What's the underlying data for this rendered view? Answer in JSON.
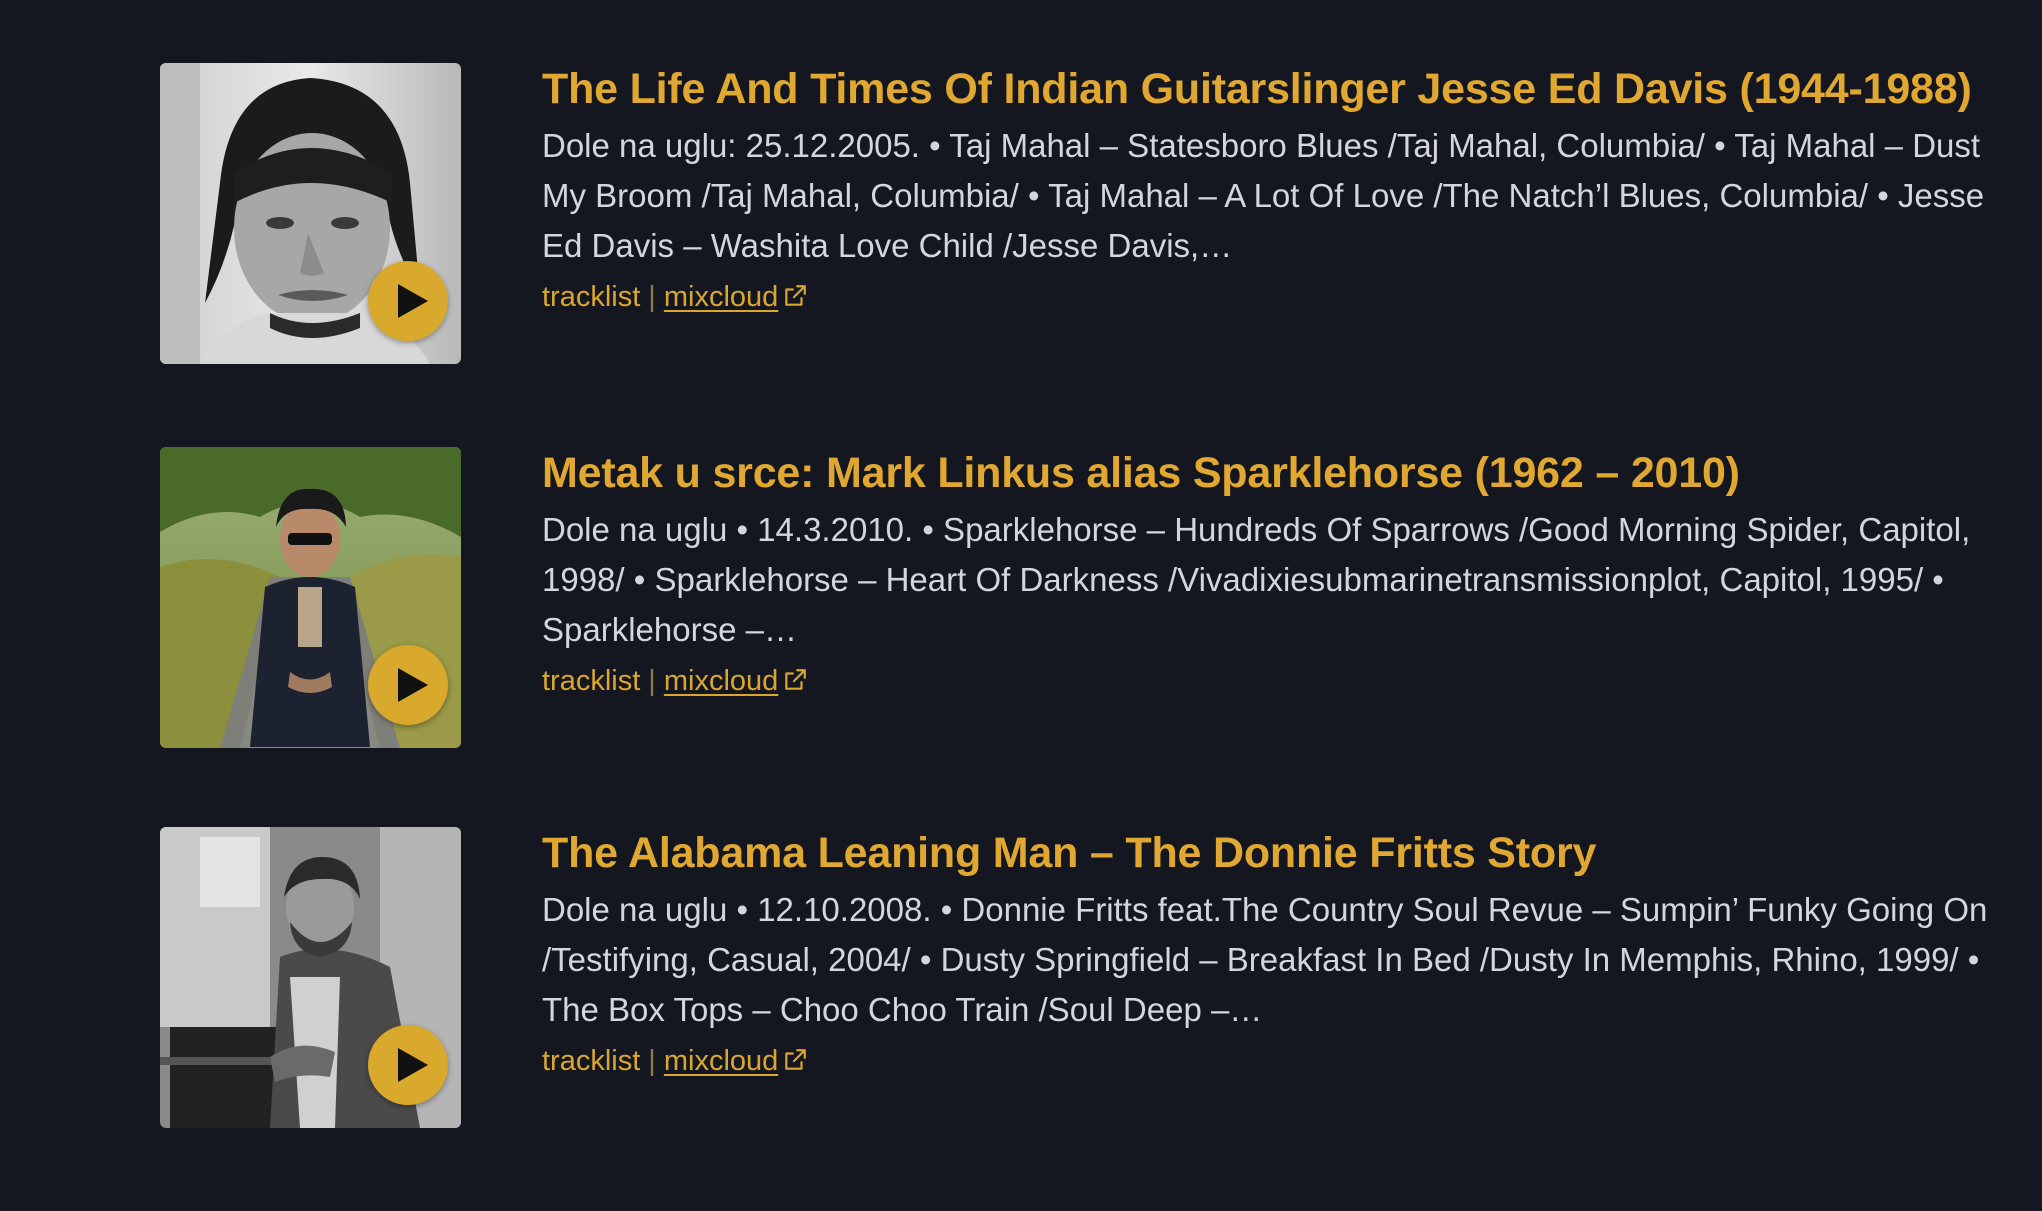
{
  "episodes": [
    {
      "title": "The Life And Times Of Indian Guitarslinger Jesse Ed Davis (1944-1988)",
      "description": "Dole na uglu: 25.12.2005.  • Taj Mahal – Statesboro Blues /Taj Mahal, Columbia/  • Taj Mahal – Dust My Broom /Taj Mahal, Columbia/  • Taj Mahal – A Lot Of Love /The Natch’l Blues, Columbia/  • Jesse Ed Davis – Washita Love Child /Jesse Davis,…",
      "tracklist_label": "tracklist",
      "mixcloud_label": "mixcloud",
      "separator": "|"
    },
    {
      "title": "Metak u srce: Mark Linkus alias Sparklehorse (1962 – 2010)",
      "description": "Dole na uglu  • 14.3.2010.  • Sparklehorse – Hundreds Of Sparrows /Good Morning Spider, Capitol, 1998/  • Sparklehorse – Heart Of Darkness /Vivadixiesubmarinetransmissionplot, Capitol, 1995/  • Sparklehorse –…",
      "tracklist_label": "tracklist",
      "mixcloud_label": "mixcloud",
      "separator": "|"
    },
    {
      "title": "The Alabama Leaning Man – The Donnie Fritts Story",
      "description": "Dole na uglu  • 12.10.2008.  • Donnie Fritts feat.The Country Soul Revue – Sumpin’ Funky Going On /Testifying, Casual, 2004/  • Dusty Springfield – Breakfast In Bed /Dusty In Memphis, Rhino, 1999/  • The Box Tops – Choo Choo Train /Soul Deep –…",
      "tracklist_label": "tracklist",
      "mixcloud_label": "mixcloud",
      "separator": "|"
    }
  ],
  "colors": {
    "background": "#14171f",
    "accent": "#e0a830",
    "text": "#d4d6dc"
  }
}
